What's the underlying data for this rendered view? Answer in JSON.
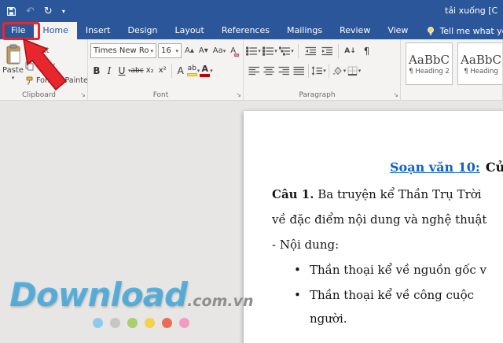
{
  "titlebar": {
    "title": "tải xuống [C"
  },
  "icons": {
    "undo": "↶",
    "redo": "↻",
    "caret": "▾",
    "launcher": "↘",
    "paragraph_mark": "¶",
    "bullet": "•"
  },
  "tabs": {
    "file": "File",
    "home": "Home",
    "others": [
      "Insert",
      "Design",
      "Layout",
      "References",
      "Mailings",
      "Review",
      "View"
    ],
    "tellme": "Tell me what you want to do..."
  },
  "ribbon": {
    "clipboard": {
      "label": "Clipboard",
      "paste": "Paste",
      "cut": "Cut",
      "copy": "Copy",
      "format_painter": "Format Painter"
    },
    "font": {
      "label": "Font",
      "name": "Times New Ro",
      "size": "16",
      "grow": "A▴",
      "shrink": "A▾",
      "case": "Aa",
      "clear": "A",
      "bold": "B",
      "italic": "I",
      "underline": "U",
      "strike": "abc",
      "subscript": "x₂",
      "superscript": "x²",
      "effects": "A",
      "highlight": "ab",
      "color": "A"
    },
    "paragraph": {
      "label": "Paragraph",
      "sort": "A↓"
    },
    "styles": {
      "items": [
        {
          "preview": "AaBbC",
          "name": "¶ Heading 2"
        },
        {
          "preview": "AaBbC",
          "name": "¶ Heading"
        }
      ]
    }
  },
  "document": {
    "heading_link": "Soạn văn 10:",
    "heading_rest": "Củ",
    "q1_label": "Câu 1.",
    "q1_text": "Ba truyện kể Thần Trụ Trời",
    "line2": "về đặc điểm nội dung và nghệ thuật",
    "line3": "- Nội dung:",
    "bullet1": "Thần thoại kể về nguồn gốc v",
    "bullet2": "Thần thoại kể về công cuộc",
    "bullet2_cont": "người."
  },
  "watermark": {
    "brand": "Download",
    "suffix": ".com.vn",
    "dot_colors": [
      "#8ecaec",
      "#c6c6c6",
      "#a8d06c",
      "#f2d349",
      "#ec6b57",
      "#f19cc0"
    ]
  }
}
